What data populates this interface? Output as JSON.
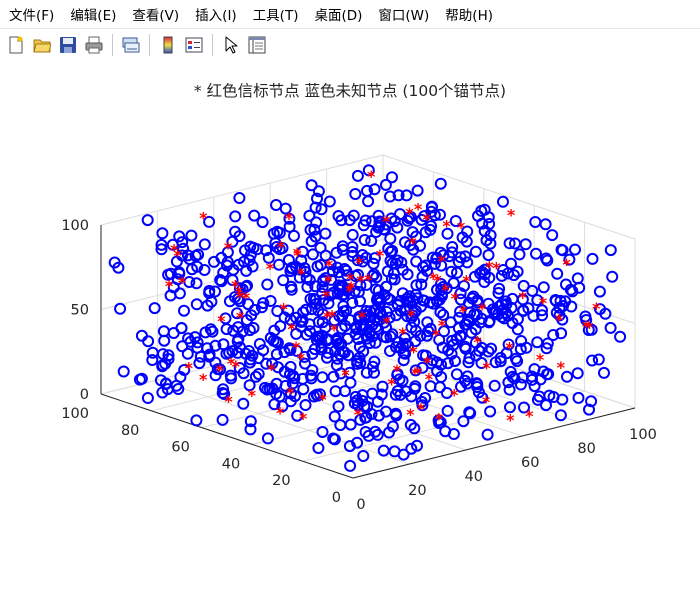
{
  "menu": [
    "文件(F)",
    "编辑(E)",
    "查看(V)",
    "插入(I)",
    "工具(T)",
    "桌面(D)",
    "窗口(W)",
    "帮助(H)"
  ],
  "toolbar": [
    "new-file-icon",
    "open-folder-icon",
    "save-icon",
    "print-icon",
    "link-plot-icon",
    "colorbar-icon",
    "legend-icon",
    "pointer-icon",
    "property-inspector-icon"
  ],
  "chart_data": {
    "type": "scatter",
    "title": "* 红色信标节点 蓝色未知节点 (100个锚节点)",
    "xlabel": "",
    "ylabel": "",
    "zlabel": "",
    "xlim": [
      0,
      100
    ],
    "ylim": [
      0,
      100
    ],
    "zlim": [
      0,
      100
    ],
    "xticks": [
      0,
      20,
      40,
      60,
      80,
      100
    ],
    "yticks": [
      0,
      20,
      40,
      60,
      80,
      100
    ],
    "zticks": [
      0,
      50,
      100
    ],
    "grid": true,
    "view": "3d",
    "series": [
      {
        "marker": "o",
        "color": "#0000ff",
        "count_shown": "about 900 (generated below)"
      },
      {
        "marker": "*",
        "color": "#ff0000",
        "count_shown": "100"
      }
    ],
    "sample_seed": 12345
  }
}
